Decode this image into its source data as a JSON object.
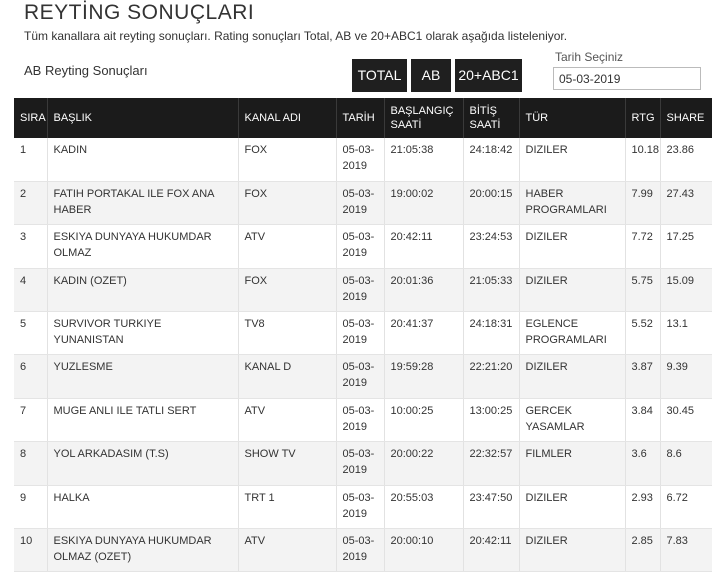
{
  "header": {
    "title": "REYTİNG SONUÇLARI",
    "description": "Tüm kanallara ait reyting sonuçları. Rating sonuçları Total, AB ve 20+ABC1 olarak aşağıda listeleniyor."
  },
  "section": {
    "title": "AB Reyting Sonuçları"
  },
  "filters": {
    "total_label": "TOTAL",
    "ab_label": "AB",
    "abc1_label": "20+ABC1",
    "date_label": "Tarih Seçiniz",
    "date_value": "05-03-2019"
  },
  "table": {
    "headers": {
      "sira": "SIRA",
      "baslik": "BAŞLIK",
      "kanal": "KANAL ADI",
      "tarih": "TARİH",
      "baslangic": "BAŞLANGIÇ SAATİ",
      "bitis": "BİTİŞ SAATİ",
      "tur": "TÜR",
      "rtg": "RTG",
      "share": "SHARE"
    },
    "rows": [
      {
        "sira": "1",
        "baslik": "KADIN",
        "kanal": "FOX",
        "tarih": "05-03-2019",
        "baslangic": "21:05:38",
        "bitis": "24:18:42",
        "tur": "DIZILER",
        "rtg": "10.18",
        "share": "23.86"
      },
      {
        "sira": "2",
        "baslik": "FATIH PORTAKAL ILE FOX ANA HABER",
        "kanal": "FOX",
        "tarih": "05-03-2019",
        "baslangic": "19:00:02",
        "bitis": "20:00:15",
        "tur": "HABER PROGRAMLARI",
        "rtg": "7.99",
        "share": "27.43"
      },
      {
        "sira": "3",
        "baslik": "ESKIYA DUNYAYA HUKUMDAR OLMAZ",
        "kanal": "ATV",
        "tarih": "05-03-2019",
        "baslangic": "20:42:11",
        "bitis": "23:24:53",
        "tur": "DIZILER",
        "rtg": "7.72",
        "share": "17.25"
      },
      {
        "sira": "4",
        "baslik": "KADIN (OZET)",
        "kanal": "FOX",
        "tarih": "05-03-2019",
        "baslangic": "20:01:36",
        "bitis": "21:05:33",
        "tur": "DIZILER",
        "rtg": "5.75",
        "share": "15.09"
      },
      {
        "sira": "5",
        "baslik": "SURVIVOR TURKIYE YUNANISTAN",
        "kanal": "TV8",
        "tarih": "05-03-2019",
        "baslangic": "20:41:37",
        "bitis": "24:18:31",
        "tur": "EGLENCE PROGRAMLARI",
        "rtg": "5.52",
        "share": "13.1"
      },
      {
        "sira": "6",
        "baslik": "YUZLESME",
        "kanal": "KANAL D",
        "tarih": "05-03-2019",
        "baslangic": "19:59:28",
        "bitis": "22:21:20",
        "tur": "DIZILER",
        "rtg": "3.87",
        "share": "9.39"
      },
      {
        "sira": "7",
        "baslik": "MUGE ANLI ILE TATLI SERT",
        "kanal": "ATV",
        "tarih": "05-03-2019",
        "baslangic": "10:00:25",
        "bitis": "13:00:25",
        "tur": "GERCEK YASAMLAR",
        "rtg": "3.84",
        "share": "30.45"
      },
      {
        "sira": "8",
        "baslik": "YOL ARKADASIM (T.S)",
        "kanal": "SHOW TV",
        "tarih": "05-03-2019",
        "baslangic": "20:00:22",
        "bitis": "22:32:57",
        "tur": "FILMLER",
        "rtg": "3.6",
        "share": "8.6"
      },
      {
        "sira": "9",
        "baslik": "HALKA",
        "kanal": "TRT 1",
        "tarih": "05-03-2019",
        "baslangic": "20:55:03",
        "bitis": "23:47:50",
        "tur": "DIZILER",
        "rtg": "2.93",
        "share": "6.72"
      },
      {
        "sira": "10",
        "baslik": "ESKIYA DUNYAYA HUKUMDAR OLMAZ (OZET)",
        "kanal": "ATV",
        "tarih": "05-03-2019",
        "baslangic": "20:00:10",
        "bitis": "20:42:11",
        "tur": "DIZILER",
        "rtg": "2.85",
        "share": "7.83"
      }
    ]
  }
}
